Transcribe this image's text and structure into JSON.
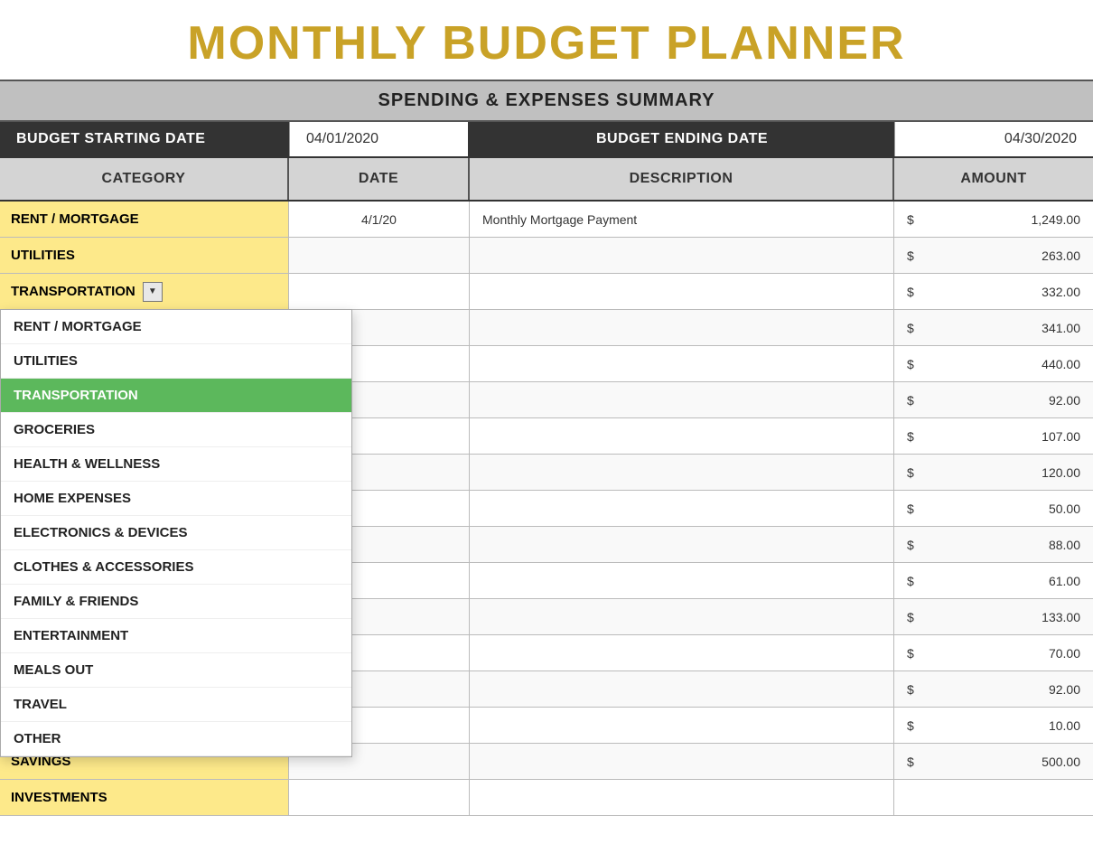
{
  "title": "MONTHLY BUDGET PLANNER",
  "subtitle": "SPENDING & EXPENSES SUMMARY",
  "budget_start_label": "BUDGET STARTING DATE",
  "budget_start_value": "04/01/2020",
  "budget_end_label": "BUDGET ENDING DATE",
  "budget_end_value": "04/30/2020",
  "table_headers": {
    "category": "CATEGORY",
    "date": "DATE",
    "description": "DESCRIPTION",
    "amount": "AMOUNT"
  },
  "rows": [
    {
      "category": "RENT / MORTGAGE",
      "date": "4/1/20",
      "description": "Monthly Mortgage Payment",
      "amount": "1,249.00",
      "yellow": true
    },
    {
      "category": "UTILITIES",
      "date": "",
      "description": "",
      "amount": "263.00",
      "yellow": true
    },
    {
      "category": "TRANSPORTATION",
      "date": "",
      "description": "",
      "amount": "332.00",
      "yellow": true,
      "has_dropdown": true
    },
    {
      "category": "",
      "date": "",
      "description": "",
      "amount": "341.00",
      "yellow": false
    },
    {
      "category": "",
      "date": "",
      "description": "",
      "amount": "440.00",
      "yellow": false
    },
    {
      "category": "",
      "date": "",
      "description": "",
      "amount": "92.00",
      "yellow": false
    },
    {
      "category": "",
      "date": "",
      "description": "",
      "amount": "107.00",
      "yellow": false
    },
    {
      "category": "",
      "date": "",
      "description": "",
      "amount": "120.00",
      "yellow": false
    },
    {
      "category": "",
      "date": "",
      "description": "",
      "amount": "50.00",
      "yellow": false
    },
    {
      "category": "",
      "date": "",
      "description": "",
      "amount": "88.00",
      "yellow": false
    },
    {
      "category": "",
      "date": "",
      "description": "",
      "amount": "61.00",
      "yellow": false
    },
    {
      "category": "",
      "date": "",
      "description": "",
      "amount": "133.00",
      "yellow": false
    },
    {
      "category": "",
      "date": "",
      "description": "",
      "amount": "70.00",
      "yellow": false
    },
    {
      "category": "",
      "date": "",
      "description": "",
      "amount": "92.00",
      "yellow": false
    },
    {
      "category": "",
      "date": "",
      "description": "",
      "amount": "10.00",
      "yellow": false
    },
    {
      "category": "SAVINGS",
      "date": "",
      "description": "",
      "amount": "500.00",
      "yellow": true
    },
    {
      "category": "INVESTMENTS",
      "date": "",
      "description": "",
      "amount": "",
      "yellow": true
    }
  ],
  "dropdown_items": [
    {
      "label": "RENT / MORTGAGE",
      "selected": false
    },
    {
      "label": "UTILITIES",
      "selected": false
    },
    {
      "label": "TRANSPORTATION",
      "selected": true
    },
    {
      "label": "GROCERIES",
      "selected": false
    },
    {
      "label": "HEALTH & WELLNESS",
      "selected": false
    },
    {
      "label": "HOME EXPENSES",
      "selected": false
    },
    {
      "label": "ELECTRONICS & DEVICES",
      "selected": false
    },
    {
      "label": "CLOTHES & ACCESSORIES",
      "selected": false
    },
    {
      "label": "FAMILY & FRIENDS",
      "selected": false
    },
    {
      "label": "ENTERTAINMENT",
      "selected": false
    },
    {
      "label": "MEALS OUT",
      "selected": false
    },
    {
      "label": "TRAVEL",
      "selected": false
    },
    {
      "label": "OTHER",
      "selected": false
    }
  ]
}
